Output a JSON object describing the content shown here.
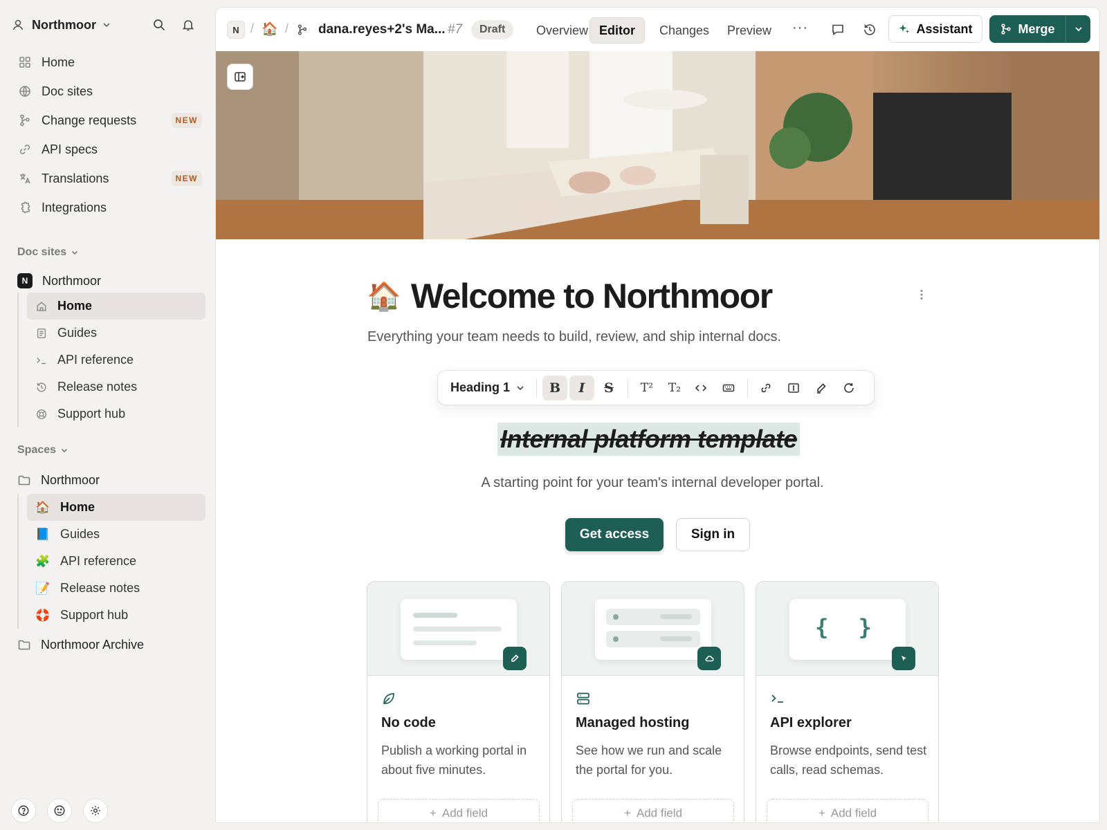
{
  "sidebar": {
    "org_name": "Northmoor",
    "nav": [
      {
        "label": "Home",
        "icon": "grid-icon"
      },
      {
        "label": "Doc sites",
        "icon": "globe-icon"
      },
      {
        "label": "Change requests",
        "icon": "branch-icon",
        "badge": "NEW"
      },
      {
        "label": "API specs",
        "icon": "link-icon"
      },
      {
        "label": "Translations",
        "icon": "translate-icon",
        "badge": "NEW"
      },
      {
        "label": "Integrations",
        "icon": "puzzle-icon"
      }
    ],
    "doc_sites_heading": "Doc sites",
    "doc_site": {
      "logo_letter": "N",
      "name": "Northmoor"
    },
    "doc_site_pages": [
      "Home",
      "Guides",
      "API reference",
      "Release notes",
      "Support hub"
    ],
    "spaces_heading": "Spaces",
    "space_name": "Northmoor",
    "space_pages": [
      {
        "label": "Home",
        "emoji": "🏠"
      },
      {
        "label": "Guides",
        "emoji": "📘"
      },
      {
        "label": "API reference",
        "emoji": "🧩"
      },
      {
        "label": "Release notes",
        "emoji": "📝"
      },
      {
        "label": "Support hub",
        "emoji": "🛟"
      }
    ],
    "archive_space": "Northmoor Archive"
  },
  "topbar": {
    "crumb_letter": "N",
    "crumb_emoji": "🏠",
    "branch_title": "dana.reyes+2's Ma...",
    "cr_number": "#7",
    "status": "Draft",
    "tabs": [
      "Overview",
      "Editor",
      "Changes",
      "Preview"
    ],
    "active_tab": "Editor",
    "more": "···",
    "assistant_label": "Assistant",
    "merge_label": "Merge"
  },
  "page": {
    "emoji": "🏠",
    "title": "Welcome to Northmoor",
    "subtitle": "Everything your team needs to build, review, and ship internal docs."
  },
  "format_bar": {
    "block_type": "Heading 1",
    "bold": "B",
    "italic": "I",
    "strike": "S",
    "superscript": "T²",
    "subscript": "T₂"
  },
  "hero": {
    "heading": "Internal platform template",
    "subheading": "A starting point for your team's internal developer portal.",
    "primary_cta": "Get access",
    "secondary_cta": "Sign in"
  },
  "cards": [
    {
      "title": "No code",
      "description": "Publish a working portal in about five minutes.",
      "add_field": "Add field",
      "icon": "leaf-icon",
      "badge_icon": "pencil-icon"
    },
    {
      "title": "Managed hosting",
      "description": "See how we run and scale the portal for you.",
      "add_field": "Add field",
      "icon": "server-icon",
      "badge_icon": "cloud-icon"
    },
    {
      "title": "API explorer",
      "description": "Browse endpoints, send test calls, read schemas.",
      "add_field": "Add field",
      "icon": "terminal-icon",
      "badge_icon": "cursor-icon",
      "braces": "{ }"
    }
  ],
  "colors": {
    "accent": "#1e5f55",
    "badge_new": "#b35a1e",
    "highlight": "#dde7e3"
  }
}
